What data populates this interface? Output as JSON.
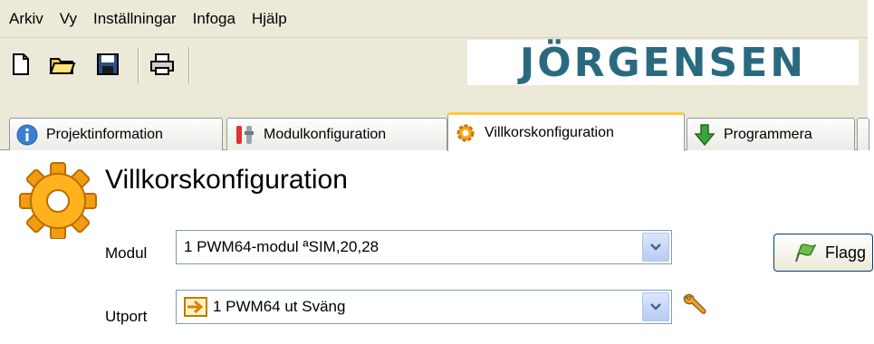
{
  "menu": {
    "items": [
      "Arkiv",
      "Vy",
      "Inställningar",
      "Infoga",
      "Hjälp"
    ]
  },
  "toolbar": {
    "icons": [
      "new-document-icon",
      "open-folder-icon",
      "save-icon",
      "print-icon"
    ]
  },
  "brand": {
    "logo_text": "JÖRGENSEN",
    "color": "#2a6a80"
  },
  "tabs": [
    {
      "label": "Projektinformation",
      "icon": "info-icon"
    },
    {
      "label": "Modulkonfiguration",
      "icon": "tools-icon"
    },
    {
      "label": "Villkorskonfiguration",
      "icon": "gear-icon",
      "active": true
    },
    {
      "label": "Programmera",
      "icon": "download-arrow-icon"
    }
  ],
  "page": {
    "title": "Villkorskonfiguration",
    "modul_label": "Modul",
    "modul_value": "1 PWM64-modul  ªSIM,20,28",
    "utport_label": "Utport",
    "utport_value": "1  PWM64 ut  Sväng",
    "flag_button_label": "Flagg"
  },
  "colors": {
    "accent_tab": "#ffc83c",
    "chrome": "#ece9d8"
  }
}
